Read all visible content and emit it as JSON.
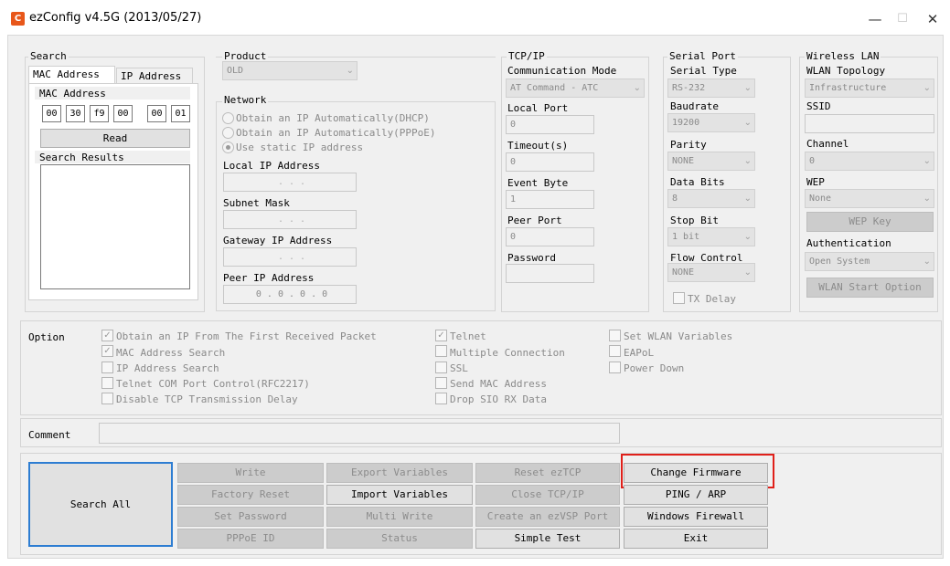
{
  "window": {
    "title": "ezConfig v4.5G (2013/05/27)",
    "icon_letter": "C",
    "minimize_glyph": "—",
    "maximize_glyph": "☐",
    "close_glyph": "✕"
  },
  "search": {
    "group_title": "Search",
    "tab_mac": "MAC Address",
    "tab_ip": "IP Address",
    "mac_label": "MAC Address",
    "mac_octets": [
      "00",
      "30",
      "f9",
      "00",
      "00",
      "01"
    ],
    "read_button": "Read",
    "results_label": "Search Results"
  },
  "product": {
    "group_title": "Product",
    "selected": "OLD"
  },
  "network": {
    "group_title": "Network",
    "radio_dhcp": "Obtain an IP Automatically(DHCP)",
    "radio_pppoe": "Obtain an IP Automatically(PPPoE)",
    "radio_static": "Use static IP address",
    "local_ip_label": "Local IP Address",
    "local_ip_value": ". . .",
    "subnet_label": "Subnet Mask",
    "subnet_value": ". . .",
    "gateway_label": "Gateway IP Address",
    "gateway_value": ". . .",
    "peer_ip_label": "Peer IP Address",
    "peer_ip_value": "0 . 0 . 0 . 0"
  },
  "tcpip": {
    "group_title": "TCP/IP",
    "comm_mode_label": "Communication Mode",
    "comm_mode_value": "AT Command - ATC",
    "local_port_label": "Local Port",
    "local_port_value": "0",
    "timeout_label": "Timeout(s)",
    "timeout_value": "0",
    "event_byte_label": "Event Byte",
    "event_byte_value": "1",
    "peer_port_label": "Peer Port",
    "peer_port_value": "0",
    "password_label": "Password",
    "password_value": ""
  },
  "serial": {
    "group_title": "Serial Port",
    "type_label": "Serial Type",
    "type_value": "RS-232",
    "baud_label": "Baudrate",
    "baud_value": "19200",
    "parity_label": "Parity",
    "parity_value": "NONE",
    "databits_label": "Data Bits",
    "databits_value": "8",
    "stopbit_label": "Stop Bit",
    "stopbit_value": "1 bit",
    "flow_label": "Flow Control",
    "flow_value": "NONE",
    "tx_delay_label": "TX Delay"
  },
  "wlan": {
    "group_title": "Wireless LAN",
    "topology_label": "WLAN Topology",
    "topology_value": "Infrastructure",
    "ssid_label": "SSID",
    "ssid_value": "",
    "channel_label": "Channel",
    "channel_value": "0",
    "wep_label": "WEP",
    "wep_value": "None",
    "wep_key_button": "WEP Key",
    "auth_label": "Authentication",
    "auth_value": "Open System",
    "start_option_button": "WLAN Start Option"
  },
  "option": {
    "label": "Option",
    "col1": [
      {
        "label": "Obtain an IP From The First Received Packet",
        "checked": true
      },
      {
        "label": "MAC Address Search",
        "checked": true
      },
      {
        "label": "IP Address Search",
        "checked": false
      },
      {
        "label": "Telnet COM Port Control(RFC2217)",
        "checked": false
      },
      {
        "label": "Disable TCP Transmission Delay",
        "checked": false
      }
    ],
    "col2": [
      {
        "label": "Telnet",
        "checked": true
      },
      {
        "label": "Multiple Connection",
        "checked": false
      },
      {
        "label": "SSL",
        "checked": false
      },
      {
        "label": "Send MAC Address",
        "checked": false
      },
      {
        "label": "Drop SIO RX Data",
        "checked": false
      }
    ],
    "col3": [
      {
        "label": "Set WLAN Variables",
        "checked": false
      },
      {
        "label": "EAPoL",
        "checked": false
      },
      {
        "label": "Power Down",
        "checked": false
      }
    ]
  },
  "comment": {
    "label": "Comment",
    "value": ""
  },
  "actions": {
    "search_all": "Search All",
    "write": "Write",
    "export_vars": "Export Variables",
    "reset_eztcp": "Reset ezTCP",
    "change_firmware": "Change Firmware",
    "factory_reset": "Factory Reset",
    "import_vars": "Import Variables",
    "close_tcpip": "Close TCP/IP",
    "ping_arp": "PING / ARP",
    "set_password": "Set Password",
    "multi_write": "Multi Write",
    "create_vsp": "Create an ezVSP Port",
    "windows_firewall": "Windows Firewall",
    "pppoe_id": "PPPoE ID",
    "status": "Status",
    "simple_test": "Simple Test",
    "exit": "Exit"
  },
  "colors": {
    "highlight": "#e0201a",
    "search_all_border": "#2d7dd2"
  }
}
